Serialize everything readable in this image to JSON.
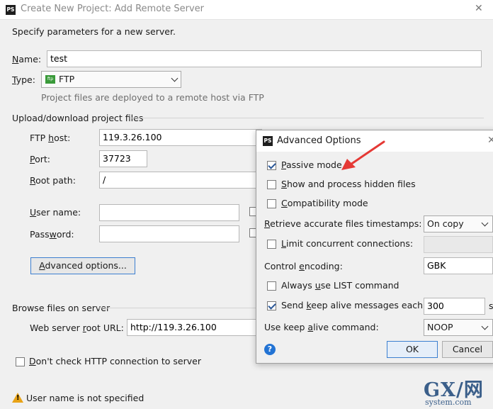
{
  "window": {
    "app_icon_text": "PS",
    "title": "Create New Project: Add Remote Server",
    "close_glyph": "✕"
  },
  "main": {
    "intro": "Specify parameters for a new server.",
    "name_label_u": "N",
    "name_label_rest": "ame:",
    "name_value": "test",
    "type_label_u": "T",
    "type_label_rest": "ype:",
    "type_icon_text": "ftp",
    "type_value": "FTP",
    "type_hint": "Project files are deployed to a remote host via FTP",
    "upload_section": "Upload/download project files",
    "ftp_host_label_pre": "FTP ",
    "ftp_host_label_u": "h",
    "ftp_host_label_post": "ost:",
    "ftp_host_value": "119.3.26.100",
    "port_label_u": "P",
    "port_label_rest": "ort:",
    "port_value": "37723",
    "root_label_u": "R",
    "root_label_rest": "oot path:",
    "root_value": "/",
    "username_label_u": "U",
    "username_label_rest": "ser name:",
    "username_value": "",
    "password_label_pre": "Pass",
    "password_label_u": "w",
    "password_label_post": "ord:",
    "password_value": "",
    "advanced_button_u": "A",
    "advanced_button_rest": "dvanced options...",
    "browse_section": "Browse files on server",
    "webroot_label_pre": "Web server ",
    "webroot_label_u": "r",
    "webroot_label_post": "oot URL:",
    "webroot_value": "http://119.3.26.100",
    "dont_check_label_u": "D",
    "dont_check_label_rest": "on't check HTTP connection to server",
    "dont_check_checked": false,
    "warning_text": "User name is not specified"
  },
  "advanced": {
    "title": "Advanced Options",
    "icon_text": "PS",
    "close_glyph": "✕",
    "passive_u": "P",
    "passive_rest": "assive mode",
    "passive_checked": true,
    "hidden_u": "S",
    "hidden_rest": "how and process hidden files",
    "hidden_checked": false,
    "compat_u": "C",
    "compat_rest": "ompatibility mode",
    "compat_checked": false,
    "timestamps_label_u": "R",
    "timestamps_label_rest": "etrieve accurate files timestamps:",
    "timestamps_value": "On copy",
    "limit_u": "L",
    "limit_rest": "imit concurrent connections:",
    "limit_checked": false,
    "limit_value": "",
    "encoding_label_pre": "Control ",
    "encoding_label_u": "e",
    "encoding_label_post": "ncoding:",
    "encoding_value": "GBK",
    "list_pre": "Always ",
    "list_u": "u",
    "list_post": "se LIST command",
    "list_checked": false,
    "keepalive_pre": "Send ",
    "keepalive_u": "k",
    "keepalive_post": "eep alive messages each:",
    "keepalive_checked": true,
    "keepalive_value": "300",
    "keepalive_unit": "s",
    "keepalive_cmd_label_pre": "Use keep ",
    "keepalive_cmd_label_u": "a",
    "keepalive_cmd_label_post": "live command:",
    "keepalive_cmd_value": "NOOP",
    "help_glyph": "?",
    "ok_label": "OK",
    "cancel_label": "Cancel"
  },
  "watermark": {
    "big": "GX/网",
    "small": "system.com"
  },
  "colors": {
    "arrow": "#e53935",
    "accent": "#2273d4",
    "warning": "#e8a317"
  }
}
